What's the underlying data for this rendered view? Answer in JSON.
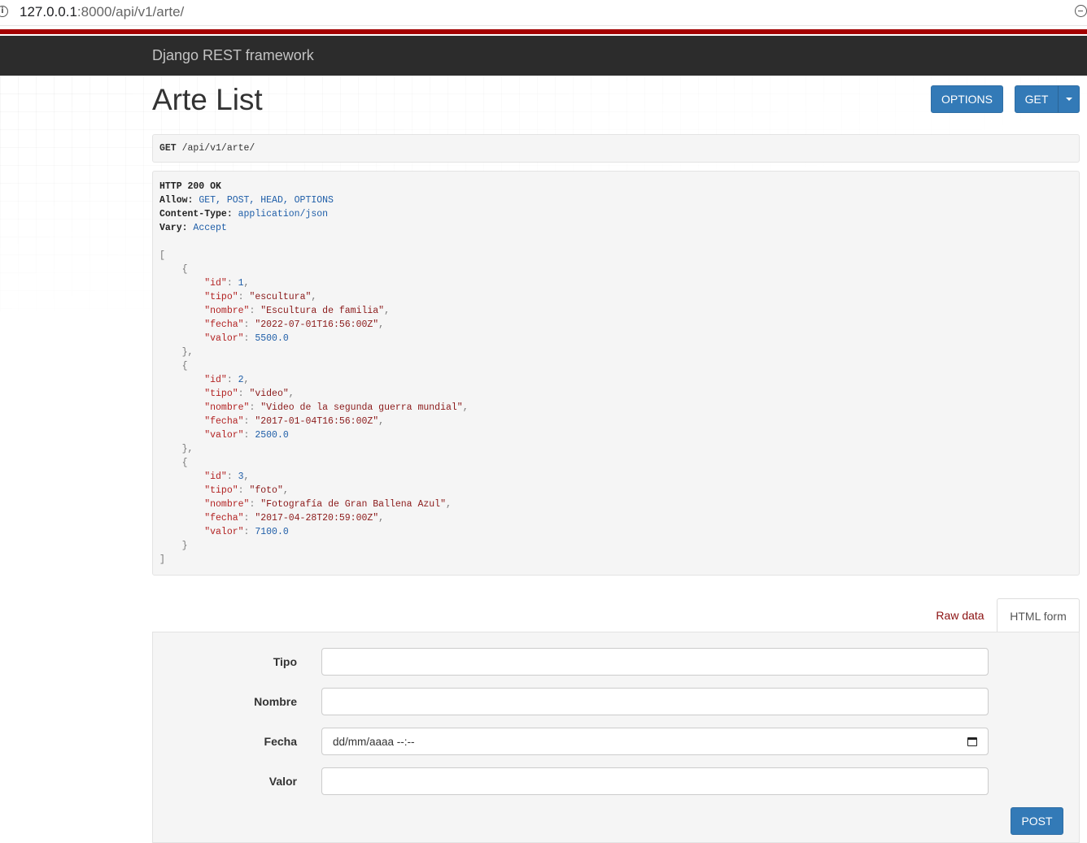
{
  "browser": {
    "url_host": "127.0.0.1",
    "url_rest": ":8000/api/v1/arte/"
  },
  "navbar": {
    "brand": "Django REST framework"
  },
  "page": {
    "title": "Arte List",
    "options_label": "OPTIONS",
    "get_label": "GET"
  },
  "request": {
    "method": "GET",
    "path": " /api/v1/arte/"
  },
  "response": {
    "status": "HTTP 200 OK",
    "headers": [
      {
        "name": "Allow:",
        "value": " GET, POST, HEAD, OPTIONS"
      },
      {
        "name": "Content-Type:",
        "value": " application/json"
      },
      {
        "name": "Vary:",
        "value": " Accept"
      }
    ],
    "items": [
      {
        "id": "1",
        "tipo": "\"escultura\"",
        "nombre": "\"Escultura de familia\"",
        "fecha": "\"2022-07-01T16:56:00Z\"",
        "valor": "5500.0"
      },
      {
        "id": "2",
        "tipo": "\"video\"",
        "nombre": "\"Video de la segunda guerra mundial\"",
        "fecha": "\"2017-01-04T16:56:00Z\"",
        "valor": "2500.0"
      },
      {
        "id": "3",
        "tipo": "\"foto\"",
        "nombre": "\"Fotografía de Gran Ballena Azul\"",
        "fecha": "\"2017-04-28T20:59:00Z\"",
        "valor": "7100.0"
      }
    ]
  },
  "tabs": {
    "raw": "Raw data",
    "html": "HTML form"
  },
  "form": {
    "tipo_label": "Tipo",
    "nombre_label": "Nombre",
    "fecha_label": "Fecha",
    "fecha_placeholder": "dd/mm/aaaa --:--",
    "valor_label": "Valor",
    "post_label": "POST"
  },
  "colors": {
    "navbar": "#2c2c2c",
    "stripe": "#a30000",
    "button": "#337ab7"
  }
}
